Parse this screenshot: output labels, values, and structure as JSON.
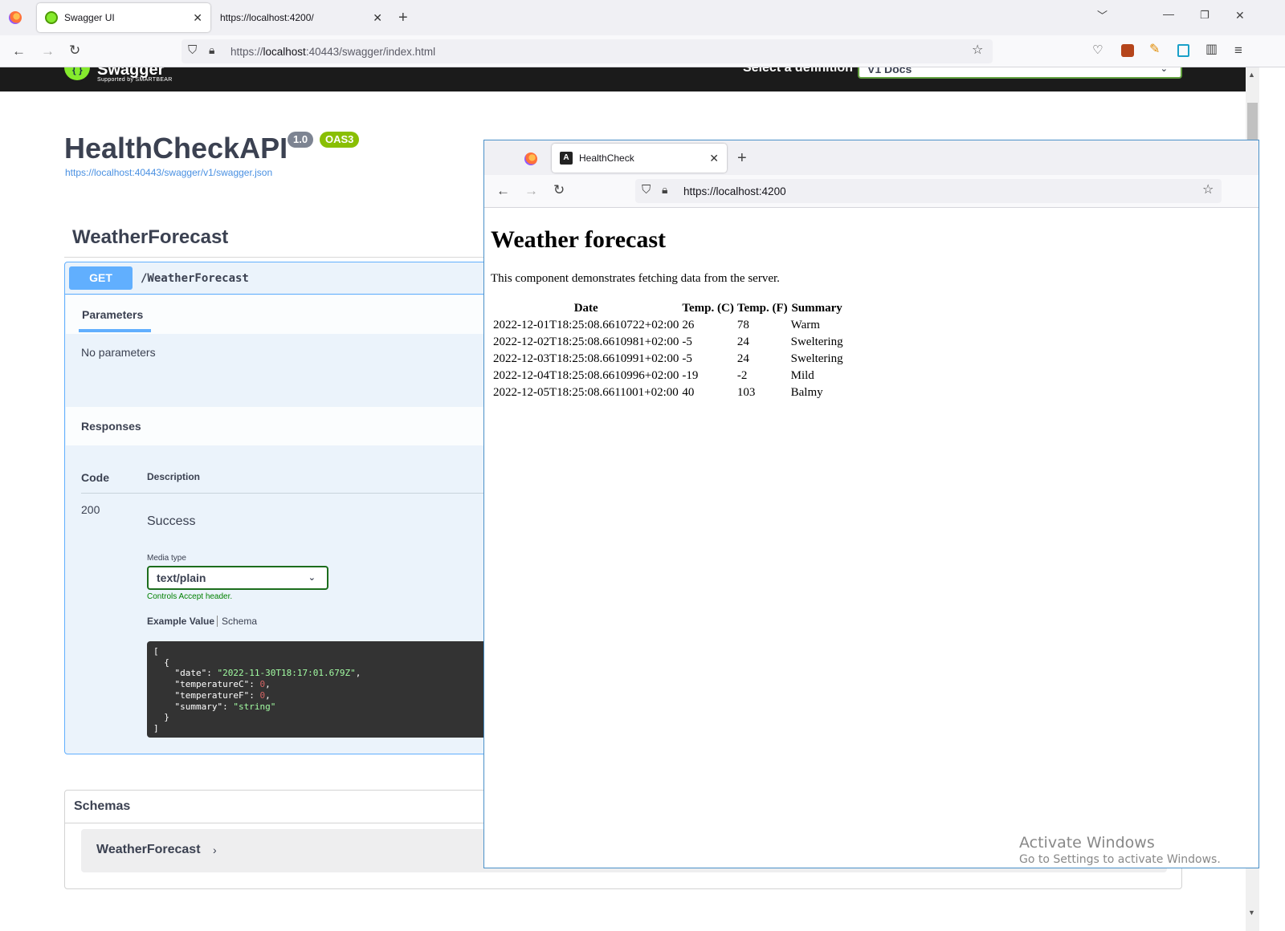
{
  "main_browser": {
    "tabs": [
      {
        "title": "Swagger UI",
        "active": true
      },
      {
        "title": "https://localhost:4200/",
        "active": false
      }
    ],
    "url_prefix": "https://",
    "url_host": "localhost",
    "url_rest": ":40443/swagger/index.html",
    "window_controls": {
      "minimize": "—",
      "restore": "❐",
      "close": "✕"
    }
  },
  "swagger": {
    "logo_word": "Swagger",
    "logo_sub": "Supported by SMARTBEAR",
    "definition_label": "Select a definition",
    "definition_value": "V1 Docs",
    "api_title": "HealthCheckAPI",
    "version_badge": "1.0",
    "oas_badge": "OAS3",
    "spec_url": "https://localhost:40443/swagger/v1/swagger.json",
    "tag": "WeatherForecast",
    "operation": {
      "method": "GET",
      "path": "/WeatherForecast",
      "parameters_tab": "Parameters",
      "no_parameters": "No parameters",
      "responses_heading": "Responses",
      "code_header": "Code",
      "description_header": "Description",
      "response_code": "200",
      "response_desc": "Success",
      "media_type_label": "Media type",
      "media_type_value": "text/plain",
      "controls_accept": "Controls Accept header.",
      "example_value_tab": "Example Value",
      "schema_tab": "Schema",
      "example": {
        "date_key": "\"date\"",
        "date_val": "\"2022-11-30T18:17:01.679Z\"",
        "tc_key": "\"temperatureC\"",
        "tc_val": "0",
        "tf_key": "\"temperatureF\"",
        "tf_val": "0",
        "summary_key": "\"summary\"",
        "summary_val": "\"string\""
      }
    },
    "schemas_heading": "Schemas",
    "schema_model": "WeatherForecast"
  },
  "second_window": {
    "tab_title": "HealthCheck",
    "url": "https://localhost:4200",
    "heading": "Weather forecast",
    "description": "This component demonstrates fetching data from the server.",
    "table": {
      "headers": [
        "Date",
        "Temp. (C)",
        "Temp. (F)",
        "Summary"
      ],
      "rows": [
        [
          "2022-12-01T18:25:08.6610722+02:00",
          "26",
          "78",
          "Warm"
        ],
        [
          "2022-12-02T18:25:08.6610981+02:00",
          "-5",
          "24",
          "Sweltering"
        ],
        [
          "2022-12-03T18:25:08.6610991+02:00",
          "-5",
          "24",
          "Sweltering"
        ],
        [
          "2022-12-04T18:25:08.6610996+02:00",
          "-19",
          "-2",
          "Mild"
        ],
        [
          "2022-12-05T18:25:08.6611001+02:00",
          "40",
          "103",
          "Balmy"
        ]
      ]
    }
  },
  "watermark": {
    "line1": "Activate Windows",
    "line2": "Go to Settings to activate Windows."
  },
  "colors": {
    "swagger_green": "#85ea2d",
    "get_blue": "#61affe",
    "badge_grey": "#7d8492",
    "badge_green": "#89bf04"
  }
}
